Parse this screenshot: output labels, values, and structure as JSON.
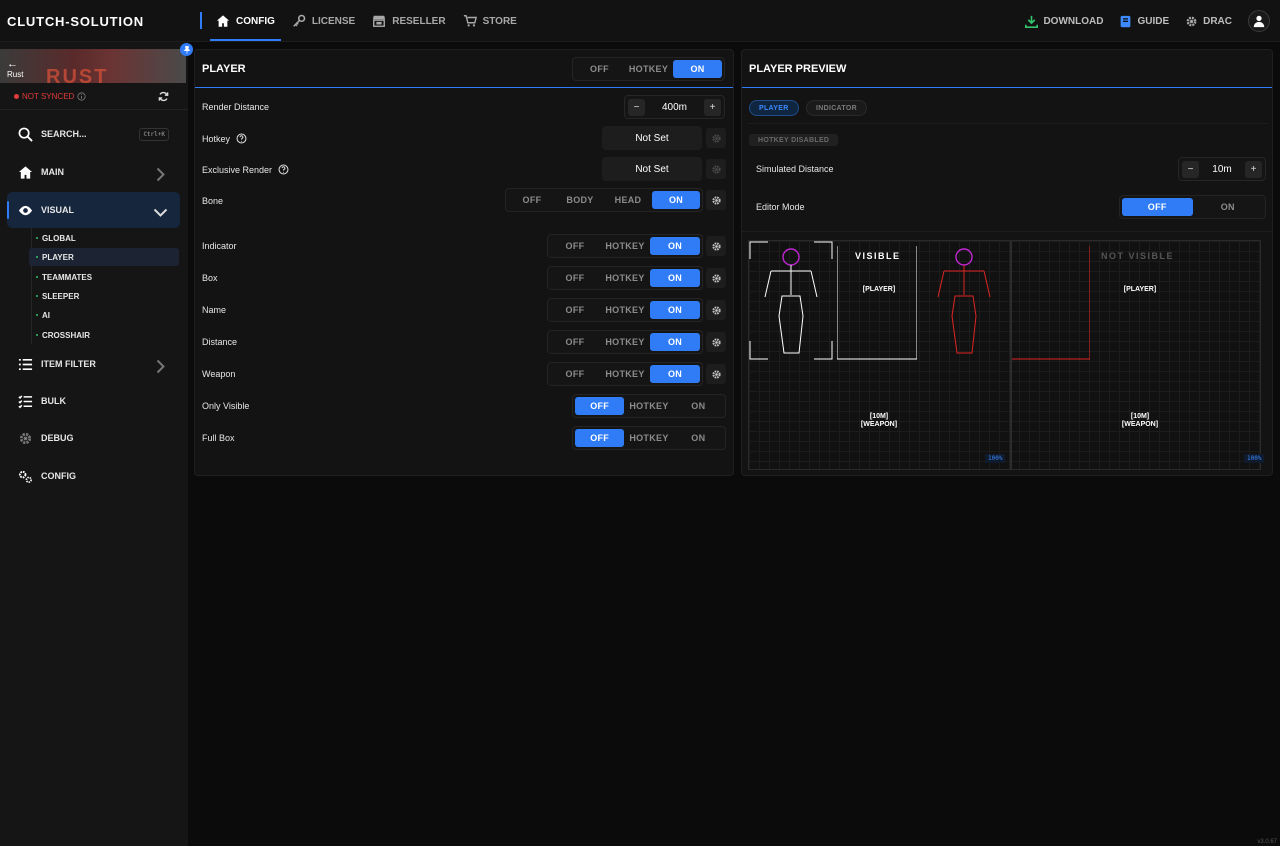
{
  "app": {
    "brand": "CLUTCH-SOLUTION",
    "version": "v3.0.67"
  },
  "nav": [
    {
      "label": "CONFIG",
      "icon": "home-icon"
    },
    {
      "label": "LICENSE",
      "icon": "key-icon"
    },
    {
      "label": "RESELLER",
      "icon": "store-icon"
    },
    {
      "label": "STORE",
      "icon": "cart-icon"
    }
  ],
  "topright": {
    "download": "DOWNLOAD",
    "guide": "GUIDE",
    "user": "DRAC"
  },
  "game": {
    "name": "Rust",
    "logo": "RUST",
    "sync_status": "NOT SYNCED"
  },
  "sidebar": {
    "search": {
      "label": "SEARCH...",
      "shortcut": "Ctrl+K"
    },
    "items": [
      "MAIN",
      "VISUAL",
      "ITEM FILTER",
      "BULK",
      "DEBUG",
      "CONFIG"
    ],
    "visual_sub": [
      "GLOBAL",
      "PLAYER",
      "TEAMMATES",
      "SLEEPER",
      "AI",
      "CROSSHAIR"
    ]
  },
  "player": {
    "title": "PLAYER",
    "mode": {
      "options": [
        "OFF",
        "HOTKEY",
        "ON"
      ],
      "selected": "ON"
    },
    "render_distance": {
      "label": "Render Distance",
      "value": "400m"
    },
    "hotkey": {
      "label": "Hotkey",
      "value": "Not Set"
    },
    "exclusive": {
      "label": "Exclusive Render",
      "value": "Not Set"
    },
    "bone": {
      "label": "Bone",
      "options": [
        "OFF",
        "BODY",
        "HEAD",
        "ON"
      ],
      "selected": "ON"
    },
    "rows": [
      {
        "label": "Indicator",
        "options": [
          "OFF",
          "HOTKEY",
          "ON"
        ],
        "selected": "ON"
      },
      {
        "label": "Box",
        "options": [
          "OFF",
          "HOTKEY",
          "ON"
        ],
        "selected": "ON"
      },
      {
        "label": "Name",
        "options": [
          "OFF",
          "HOTKEY",
          "ON"
        ],
        "selected": "ON"
      },
      {
        "label": "Distance",
        "options": [
          "OFF",
          "HOTKEY",
          "ON"
        ],
        "selected": "ON"
      },
      {
        "label": "Weapon",
        "options": [
          "OFF",
          "HOTKEY",
          "ON"
        ],
        "selected": "ON"
      },
      {
        "label": "Only Visible",
        "options": [
          "OFF",
          "HOTKEY",
          "ON"
        ],
        "selected": "OFF"
      },
      {
        "label": "Full Box",
        "options": [
          "OFF",
          "HOTKEY",
          "ON"
        ],
        "selected": "OFF"
      }
    ]
  },
  "preview": {
    "title": "PLAYER PREVIEW",
    "tabs": [
      "PLAYER",
      "INDICATOR"
    ],
    "hotkey_badge": "HOTKEY DISABLED",
    "sim_distance": {
      "label": "Simulated Distance",
      "value": "10m"
    },
    "editor_mode": {
      "label": "Editor Mode",
      "options": [
        "OFF",
        "ON"
      ],
      "selected": "OFF"
    },
    "visible": {
      "title": "VISIBLE",
      "name": "[PLAYER]",
      "distance": "[10M]",
      "weapon": "[WEAPON]",
      "zoom": "100%",
      "color": "#ffffff",
      "head_color": "#c026d3"
    },
    "not_visible": {
      "title": "NOT VISIBLE",
      "name": "[PLAYER]",
      "distance": "[10M]",
      "weapon": "[WEAPON]",
      "zoom": "100%",
      "color": "#e02424",
      "head_color": "#c026d3"
    }
  },
  "colors": {
    "accent": "#2f7cf6",
    "sync_error": "#e13b3b",
    "download": "#33c36b"
  }
}
